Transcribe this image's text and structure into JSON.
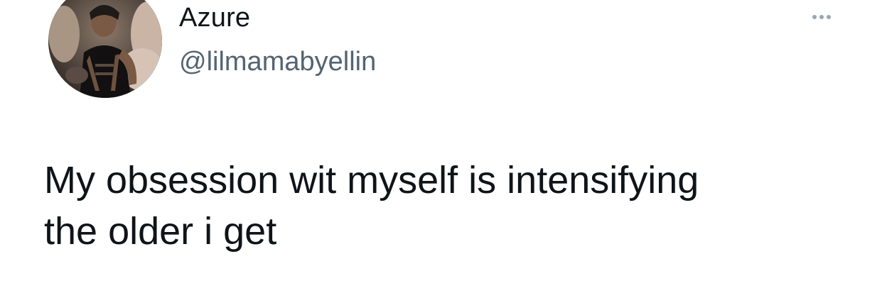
{
  "author": {
    "display_name": "Azure",
    "handle": "@lilmamabyellin"
  },
  "tweet": {
    "lines": [
      "My obsession wit myself is intensifying",
      "the older i get"
    ]
  },
  "icons": {
    "more": "more-horizontal-icon"
  },
  "colors": {
    "text": "#0f1419",
    "secondary": "#536471",
    "icon": "#9aa6b0",
    "background": "#ffffff"
  }
}
